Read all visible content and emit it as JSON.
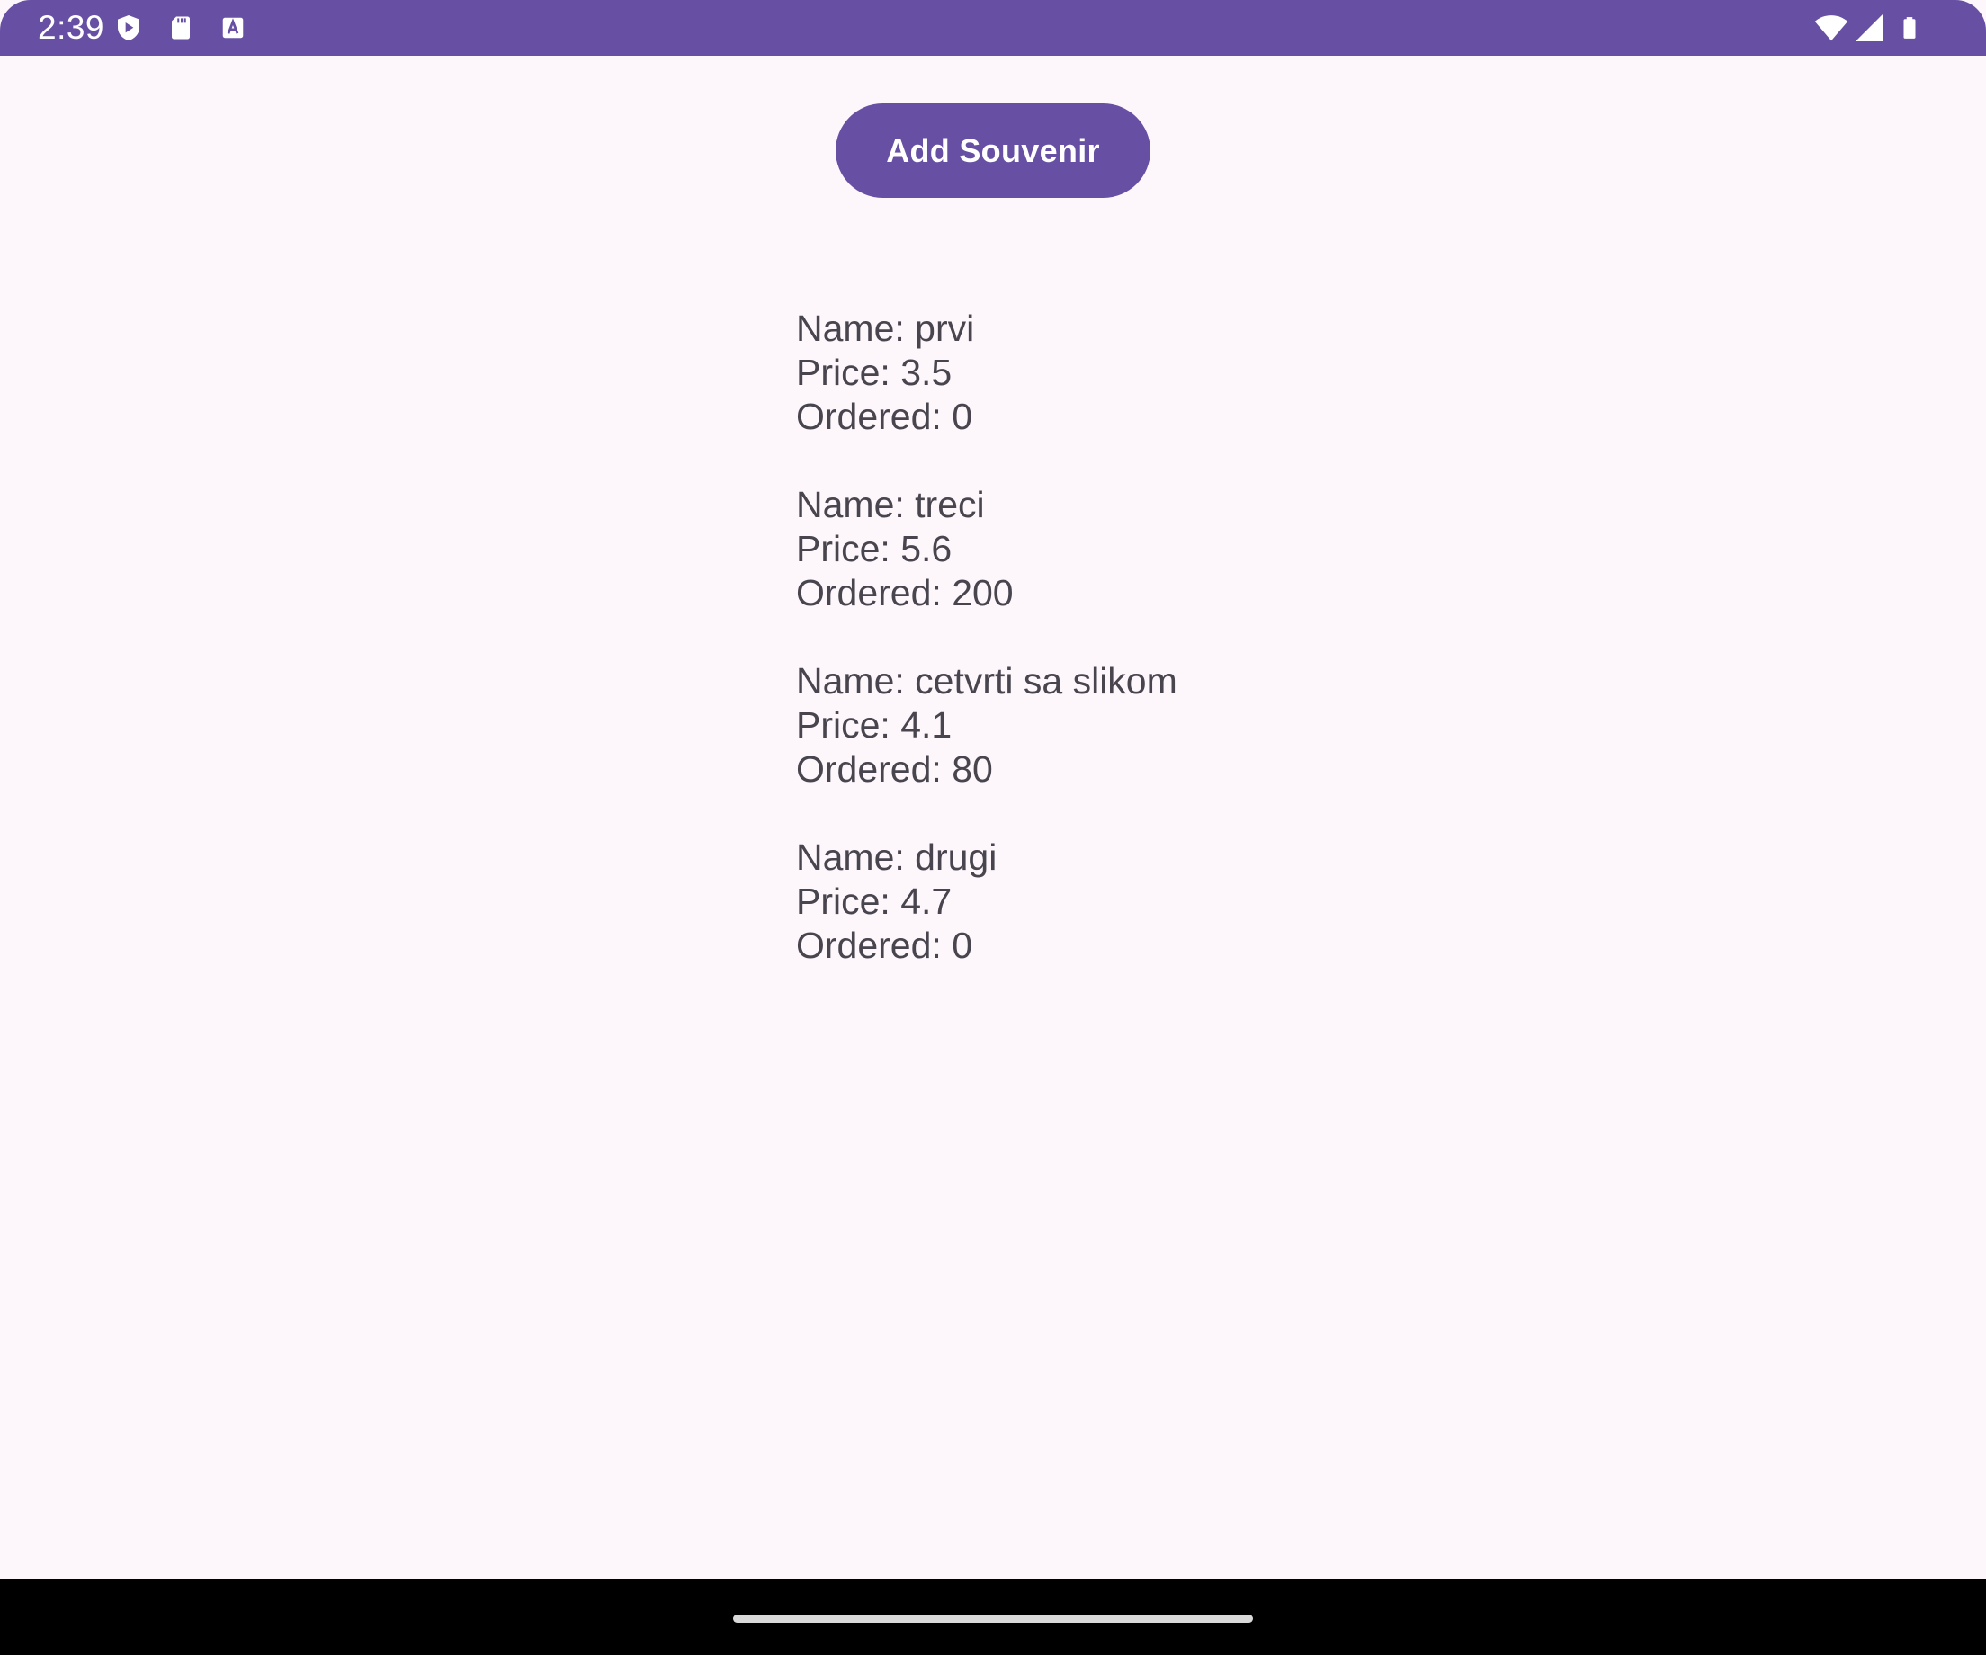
{
  "status_bar": {
    "time": "2:39",
    "icons_left": [
      "play-protect-icon",
      "sd-card-icon",
      "accessibility-a-icon"
    ],
    "icons_right": [
      "wifi-icon",
      "cell-signal-icon",
      "battery-icon"
    ],
    "color": "#6750a4"
  },
  "actions": {
    "add_souvenir": "Add Souvenir"
  },
  "souvenirs": [
    {
      "name": "Name: prvi",
      "price": "Price: 3.5",
      "ordered": "Ordered: 0"
    },
    {
      "name": "Name: treci",
      "price": "Price: 5.6",
      "ordered": "Ordered: 200"
    },
    {
      "name": "Name: cetvrti sa slikom",
      "price": "Price: 4.1",
      "ordered": "Ordered: 80"
    },
    {
      "name": "Name: drugi",
      "price": "Price: 4.7",
      "ordered": "Ordered: 0"
    }
  ],
  "colors": {
    "accent": "#6750a4",
    "background": "#fdf7fc",
    "text": "#49454f"
  }
}
